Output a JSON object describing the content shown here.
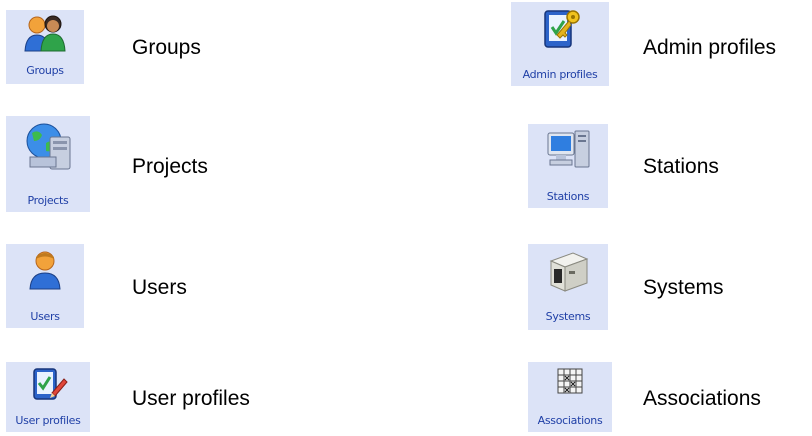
{
  "items": [
    {
      "id": "groups",
      "tile_caption": "Groups",
      "label": "Groups",
      "icon": "groups-icon"
    },
    {
      "id": "admin-profiles",
      "tile_caption": "Admin profiles",
      "label": "Admin profiles",
      "icon": "admin-profile-key-icon"
    },
    {
      "id": "projects",
      "tile_caption": "Projects",
      "label": "Projects",
      "icon": "projects-globe-computer-icon"
    },
    {
      "id": "stations",
      "tile_caption": "Stations",
      "label": "Stations",
      "icon": "stations-computer-icon"
    },
    {
      "id": "users",
      "tile_caption": "Users",
      "label": "Users",
      "icon": "user-icon"
    },
    {
      "id": "systems",
      "tile_caption": "Systems",
      "label": "Systems",
      "icon": "systems-machine-icon"
    },
    {
      "id": "user-profiles",
      "tile_caption": "User profiles",
      "label": "User profiles",
      "icon": "user-profile-pencil-icon"
    },
    {
      "id": "associations",
      "tile_caption": "Associations",
      "label": "Associations",
      "icon": "associations-grid-icon"
    }
  ]
}
